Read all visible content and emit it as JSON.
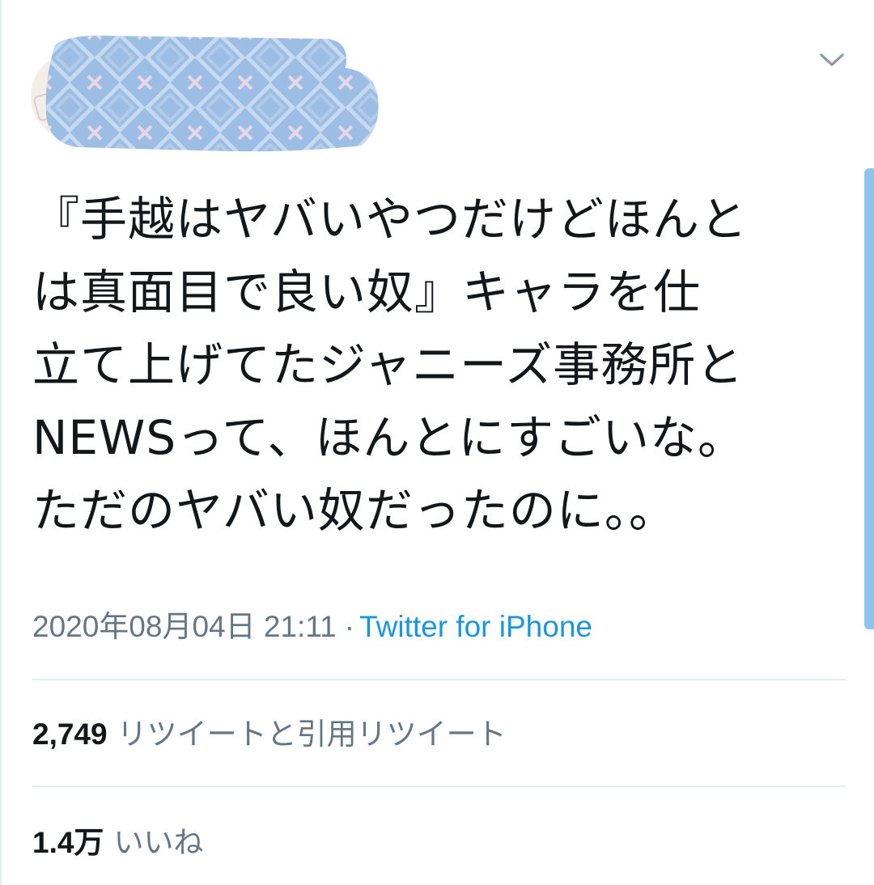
{
  "tweet": {
    "text_lines": [
      "『手越はヤバいやつだけどほんと",
      "は真面目で良い奴』キャラを仕",
      "立て上げてたジャニーズ事務所と",
      "NEWSって、ほんとにすごいな。",
      "ただのヤバい奴だったのに。。"
    ],
    "timestamp": "2020年08月04日 21:11",
    "separator": "·",
    "source": "Twitter for iPhone"
  },
  "stats": {
    "retweets": {
      "count": "2,749",
      "label": "リツイートと引用リツイート"
    },
    "likes": {
      "count": "1.4万",
      "label": "いいね"
    }
  },
  "icons": {
    "menu": "chevron-down-icon"
  },
  "colors": {
    "text": "#14171a",
    "secondary": "#657786",
    "link": "#1b95e0",
    "divider": "#e6ecf0",
    "redaction": "#9cbde4"
  }
}
